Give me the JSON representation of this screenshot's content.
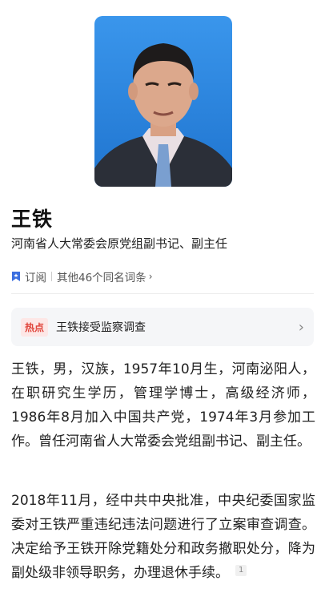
{
  "person": {
    "name": "王铁",
    "title": "河南省人大常委会原党组副书记、副主任"
  },
  "meta": {
    "subscribe_label": "订阅",
    "homonyms_label": "其他46个同名词条"
  },
  "hot": {
    "badge": "热点",
    "text": "王铁接受监察调查"
  },
  "body": {
    "paragraph1": "王铁，男，汉族，1957年10月生，河南泌阳人，在职研究生学历，管理学博士，高级经济师，1986年8月加入中国共产党，1974年3月参加工作。曾任河南省人大常委会党组副书记、副主任。",
    "paragraph2": "2018年11月，经中共中央批准，中央纪委国家监委对王铁严重违纪违法问题进行了立案审查调查。决定给予王铁开除党籍处分和政务撤职处分，降为副处级非领导职务，办理退休手续。",
    "footnote": "1"
  },
  "colors": {
    "accent_blue": "#3b6fe0",
    "hot_red": "#e0443a",
    "portrait_bg": "#2f8de6"
  },
  "icons": {
    "subscribe": "bookmark-icon",
    "more": "chevron-right-icon"
  }
}
